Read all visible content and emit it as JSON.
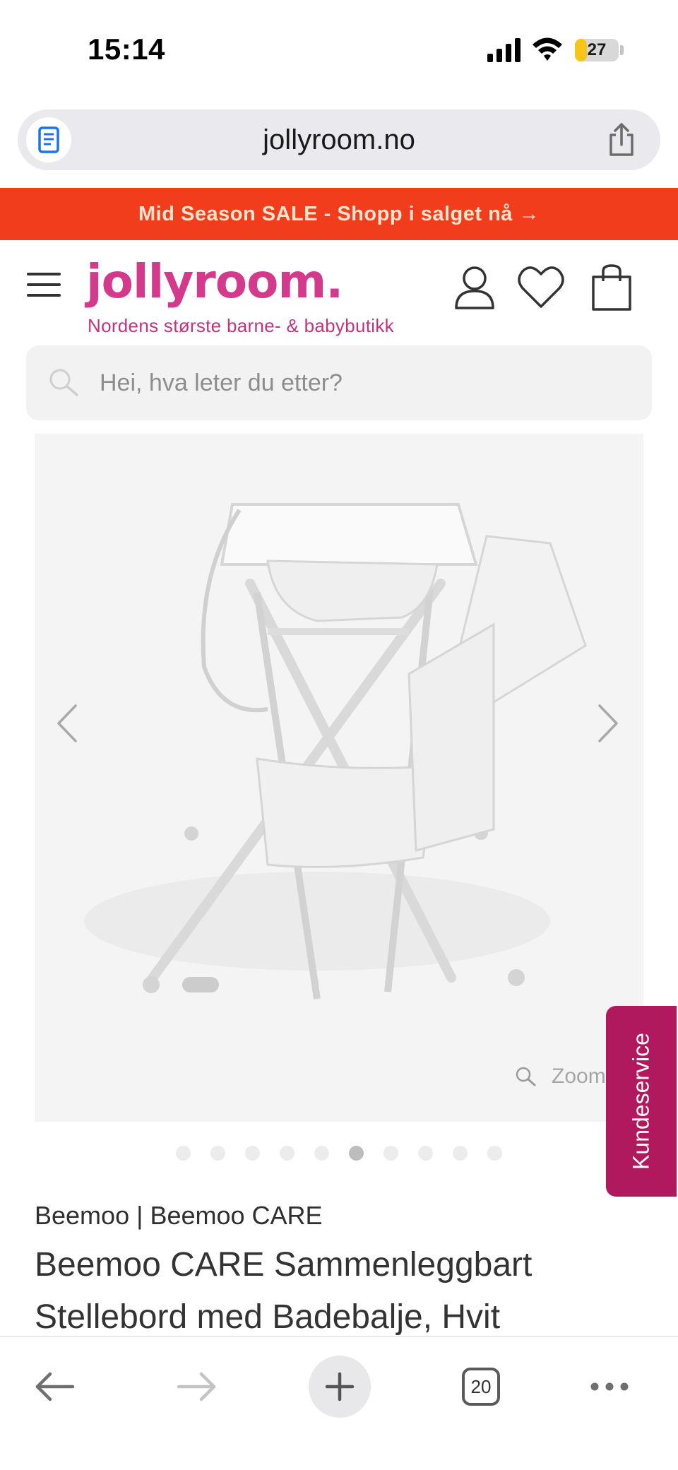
{
  "status_bar": {
    "time": "15:14",
    "battery": "27",
    "battery_level": 0.27
  },
  "browser": {
    "url": "jollyroom.no",
    "reader_icon": "reader-mode-icon",
    "share_icon": "share-icon"
  },
  "promo": {
    "text": "Mid Season SALE - Shopp i salget nå →"
  },
  "header": {
    "logo": "jollyroom.",
    "tagline": "Nordens største barne- & babybutikk",
    "icons": [
      "menu-icon",
      "account-icon",
      "heart-icon",
      "bag-icon"
    ]
  },
  "search": {
    "placeholder": "Hei, hva leter du etter?"
  },
  "gallery": {
    "zoom_label": "Zoom",
    "dot_count": 10,
    "active_index": 5
  },
  "support": {
    "label": "Kundeservice"
  },
  "product": {
    "brand": "Beemoo | Beemoo CARE",
    "title": "Beemoo CARE Sammenleggbart Stellebord med Badebalje, Hvit"
  },
  "toolbar": {
    "tab_count": "20"
  },
  "colors": {
    "promo": "#f23d1d",
    "brand_pink": "#d33a8b",
    "support": "#b1195f"
  }
}
